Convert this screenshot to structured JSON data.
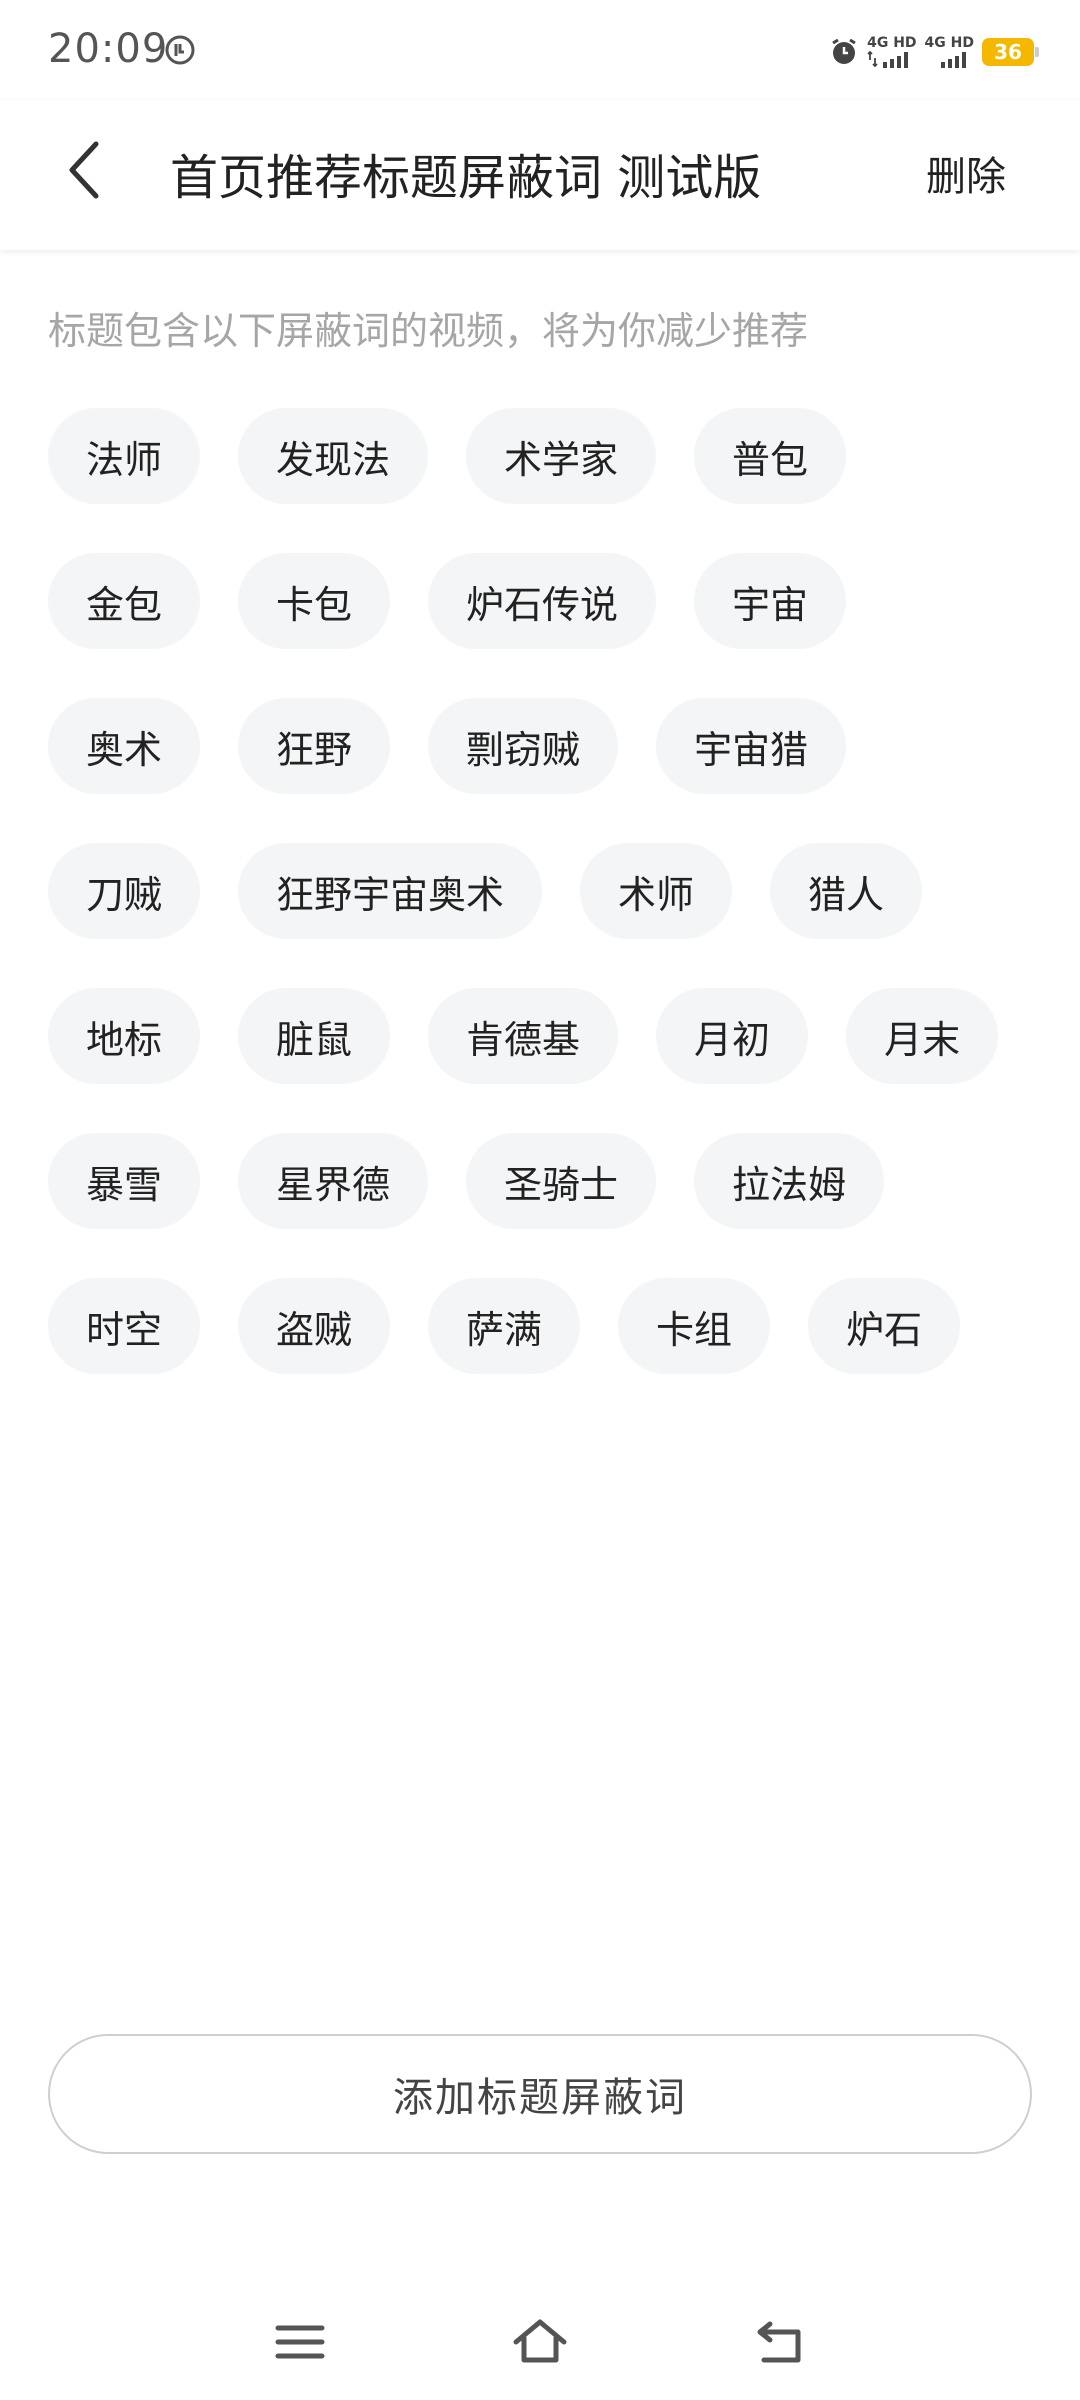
{
  "status": {
    "time": "20:09",
    "network_1": "4G HD",
    "network_2": "4G HD",
    "battery": "36"
  },
  "header": {
    "title": "首页推荐标题屏蔽词 测试版",
    "delete_label": "删除"
  },
  "description": "标题包含以下屏蔽词的视频，将为你减少推荐",
  "tags": [
    [
      "法师",
      "发现法",
      "术学家",
      "普包"
    ],
    [
      "金包",
      "卡包",
      "炉石传说",
      "宇宙"
    ],
    [
      "奥术",
      "狂野",
      "剽窃贼",
      "宇宙猎"
    ],
    [
      "刀贼",
      "狂野宇宙奥术",
      "术师",
      "猎人"
    ],
    [
      "地标",
      "脏鼠",
      "肯德基",
      "月初",
      "月末"
    ],
    [
      "暴雪",
      "星界德",
      "圣骑士",
      "拉法姆"
    ],
    [
      "时空",
      "盗贼",
      "萨满",
      "卡组",
      "炉石"
    ]
  ],
  "add_button_label": "添加标题屏蔽词",
  "icons": {
    "back": "chevron-left-icon",
    "alarm": "alarm-icon",
    "nav_menu": "menu-icon",
    "nav_home": "home-icon",
    "nav_back": "back-arrow-icon"
  },
  "colors": {
    "tag_bg": "#f4f5f7",
    "description": "#a6a6a6",
    "battery": "#f5b800"
  }
}
